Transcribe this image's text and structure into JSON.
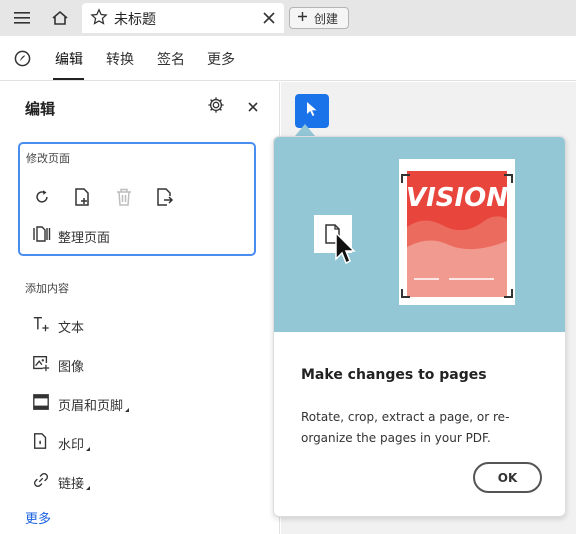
{
  "tabbar": {
    "tab_title": "未标题",
    "new_button_label": "创建"
  },
  "toolbar": {
    "menu": [
      "编辑",
      "转换",
      "签名",
      "更多"
    ],
    "active": "编辑"
  },
  "panel": {
    "title": "编辑",
    "modify_pages": {
      "heading": "修改页面",
      "organize_label": "整理页面"
    },
    "add_content": {
      "heading": "添加内容",
      "items": [
        "文本",
        "图像",
        "页眉和页脚",
        "水印",
        "链接"
      ]
    },
    "more_link": "更多"
  },
  "popover": {
    "illustration_text": "VISION",
    "title": "Make changes to pages",
    "description": "Rotate, crop, extract a page, or re-organize the pages in your PDF.",
    "ok_label": "OK"
  },
  "colors": {
    "accent": "#1a73e8",
    "focus_border": "#4a8df0",
    "illustration_bg": "#93c7d6",
    "poster_red": "#e8453c"
  },
  "icons": [
    "hamburger-menu-icon",
    "home-icon",
    "star-icon",
    "close-icon",
    "plus-icon",
    "acrobat-logo-icon",
    "gear-icon",
    "rotate-icon",
    "insert-page-icon",
    "delete-icon",
    "extract-page-icon",
    "organize-pages-icon",
    "add-text-icon",
    "add-image-icon",
    "header-footer-icon",
    "watermark-icon",
    "link-icon",
    "select-pointer-icon"
  ]
}
